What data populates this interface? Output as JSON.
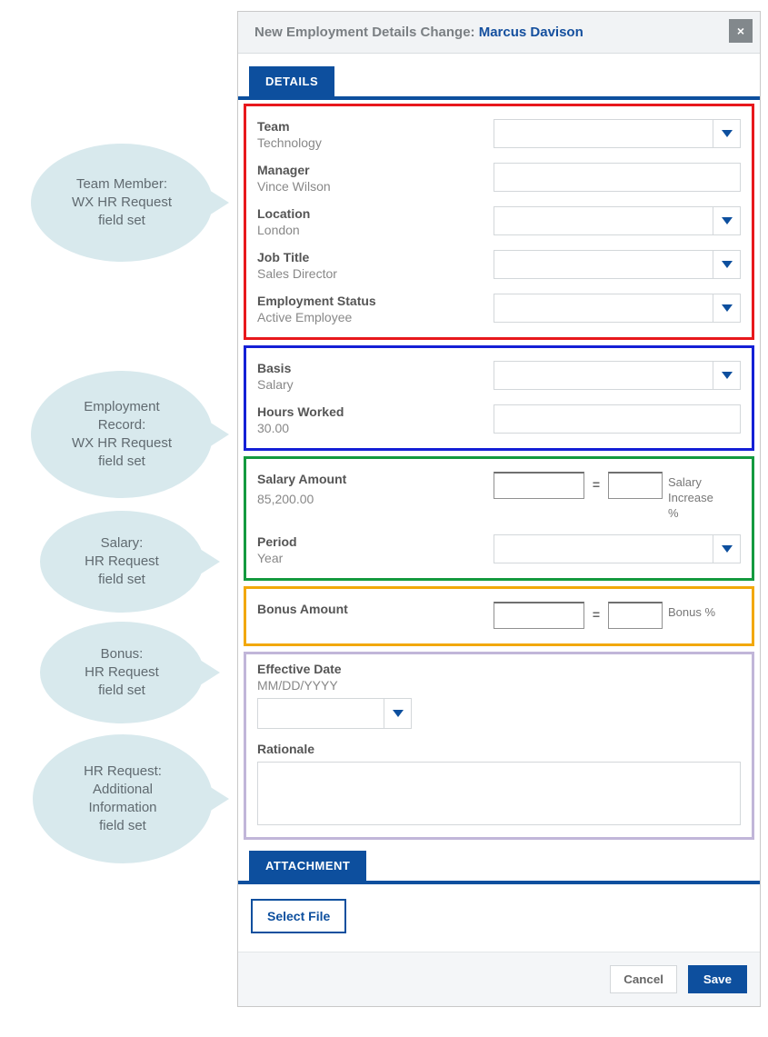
{
  "callouts": {
    "team_member": "Team Member:\nWX HR Request\nfield set",
    "employment_record": "Employment\nRecord:\nWX HR Request\nfield set",
    "salary": "Salary:\nHR Request\nfield set",
    "bonus": "Bonus:\nHR Request\nfield set",
    "additional": "HR Request:\nAdditional\nInformation\nfield set"
  },
  "modal": {
    "title_prefix": "New Employment Details Change: ",
    "person": "Marcus Davison",
    "close_glyph": "×"
  },
  "tabs": {
    "details": "DETAILS",
    "attachment": "ATTACHMENT"
  },
  "team_member": {
    "team_label": "Team",
    "team_value": "Technology",
    "manager_label": "Manager",
    "manager_value": "Vince Wilson",
    "location_label": "Location",
    "location_value": "London",
    "job_title_label": "Job Title",
    "job_title_value": "Sales Director",
    "employment_status_label": "Employment Status",
    "employment_status_value": "Active Employee"
  },
  "employment_record": {
    "basis_label": "Basis",
    "basis_value": "Salary",
    "hours_label": "Hours Worked",
    "hours_value": "30.00"
  },
  "salary": {
    "amount_label": "Salary Amount",
    "amount_value": "85,200.00",
    "increase_label": "Salary Increase %",
    "period_label": "Period",
    "period_value": "Year"
  },
  "bonus": {
    "amount_label": "Bonus Amount",
    "percent_label": "Bonus %"
  },
  "additional": {
    "effective_label": "Effective Date",
    "effective_placeholder": "MM/DD/YYYY",
    "rationale_label": "Rationale"
  },
  "attachment": {
    "select_file": "Select File"
  },
  "footer": {
    "cancel": "Cancel",
    "save": "Save"
  }
}
